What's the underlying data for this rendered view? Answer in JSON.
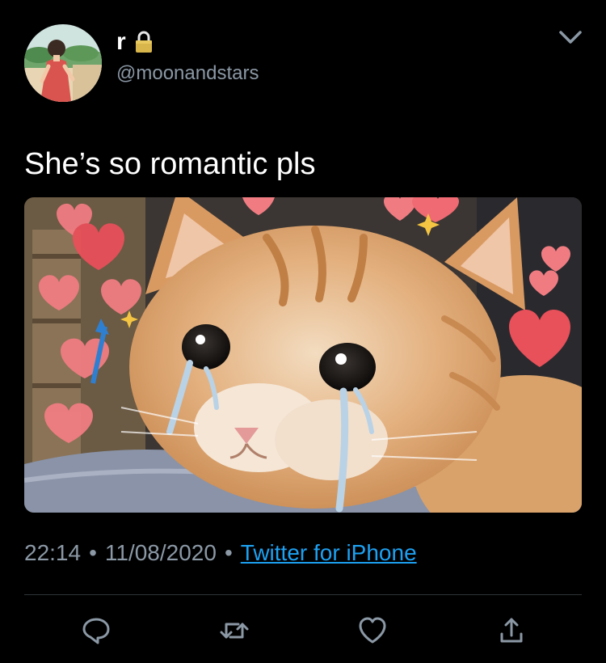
{
  "tweet": {
    "author": {
      "display_name": "r",
      "handle": "@moonandstars",
      "protected": true
    },
    "text": "She’s so romantic pls",
    "media": {
      "description_icon": "crying-cat-image"
    },
    "time": "22:14",
    "separator": "•",
    "date": "11/08/2020",
    "source": "Twitter for iPhone"
  },
  "actions": {
    "reply": "reply-icon",
    "retweet": "retweet-icon",
    "like": "heart-icon",
    "share": "share-icon"
  },
  "colors": {
    "background": "#000000",
    "text": "#ffffff",
    "secondary": "#8b98a5",
    "link": "#1da1f2",
    "divider": "#2f3336"
  }
}
